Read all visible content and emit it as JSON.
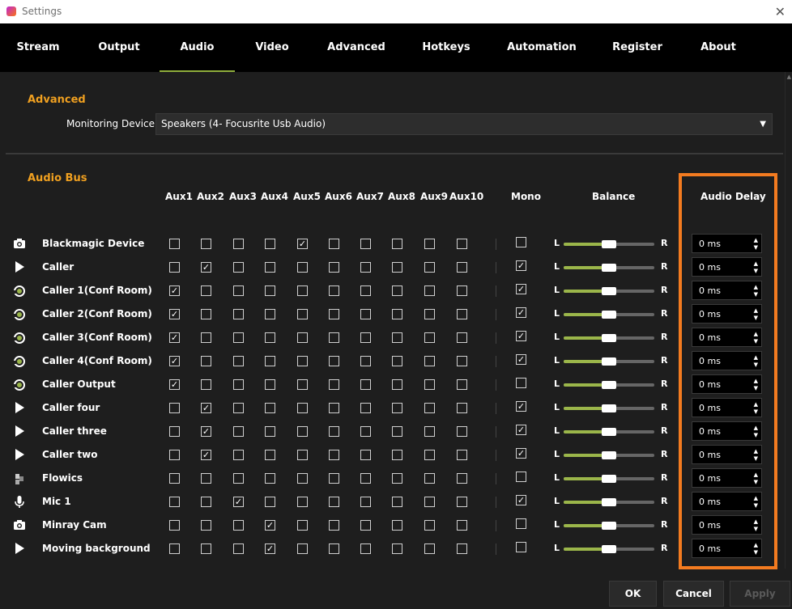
{
  "window": {
    "title": "Settings"
  },
  "tabs": [
    {
      "label": "Stream"
    },
    {
      "label": "Output"
    },
    {
      "label": "Audio"
    },
    {
      "label": "Video"
    },
    {
      "label": "Advanced"
    },
    {
      "label": "Hotkeys"
    },
    {
      "label": "Automation"
    },
    {
      "label": "Register"
    },
    {
      "label": "About"
    }
  ],
  "active_tab": "Audio",
  "advanced": {
    "title": "Advanced",
    "monitoring_label": "Monitoring Device",
    "monitoring_value": "Speakers (4- Focusrite Usb Audio)"
  },
  "audio_bus": {
    "title": "Audio Bus",
    "aux_headers": [
      "Aux1",
      "Aux2",
      "Aux3",
      "Aux4",
      "Aux5",
      "Aux6",
      "Aux7",
      "Aux8",
      "Aux9",
      "Aux10"
    ],
    "mono_header": "Mono",
    "balance_header": "Balance",
    "delay_header": "Audio Delay",
    "balance_left": "L",
    "balance_right": "R",
    "rows": [
      {
        "name": "Blackmagic Device",
        "icon": "camera-icon",
        "aux": [
          0,
          0,
          0,
          0,
          1,
          0,
          0,
          0,
          0,
          0
        ],
        "mono": 0,
        "balance": 0.5,
        "delay": "0 ms"
      },
      {
        "name": "Caller",
        "icon": "play-icon",
        "aux": [
          0,
          1,
          0,
          0,
          0,
          0,
          0,
          0,
          0,
          0
        ],
        "mono": 1,
        "balance": 0.5,
        "delay": "0 ms"
      },
      {
        "name": "Caller 1(Conf Room)",
        "icon": "refresh-icon",
        "aux": [
          1,
          0,
          0,
          0,
          0,
          0,
          0,
          0,
          0,
          0
        ],
        "mono": 1,
        "balance": 0.5,
        "delay": "0 ms"
      },
      {
        "name": "Caller 2(Conf Room)",
        "icon": "refresh-icon",
        "aux": [
          1,
          0,
          0,
          0,
          0,
          0,
          0,
          0,
          0,
          0
        ],
        "mono": 1,
        "balance": 0.5,
        "delay": "0 ms"
      },
      {
        "name": "Caller 3(Conf Room)",
        "icon": "refresh-icon",
        "aux": [
          1,
          0,
          0,
          0,
          0,
          0,
          0,
          0,
          0,
          0
        ],
        "mono": 1,
        "balance": 0.5,
        "delay": "0 ms"
      },
      {
        "name": "Caller 4(Conf Room)",
        "icon": "refresh-icon",
        "aux": [
          1,
          0,
          0,
          0,
          0,
          0,
          0,
          0,
          0,
          0
        ],
        "mono": 1,
        "balance": 0.5,
        "delay": "0 ms"
      },
      {
        "name": "Caller Output",
        "icon": "refresh-icon",
        "aux": [
          1,
          0,
          0,
          0,
          0,
          0,
          0,
          0,
          0,
          0
        ],
        "mono": 0,
        "balance": 0.5,
        "delay": "0 ms"
      },
      {
        "name": "Caller four",
        "icon": "play-icon",
        "aux": [
          0,
          1,
          0,
          0,
          0,
          0,
          0,
          0,
          0,
          0
        ],
        "mono": 1,
        "balance": 0.5,
        "delay": "0 ms"
      },
      {
        "name": "Caller three",
        "icon": "play-icon",
        "aux": [
          0,
          1,
          0,
          0,
          0,
          0,
          0,
          0,
          0,
          0
        ],
        "mono": 1,
        "balance": 0.5,
        "delay": "0 ms"
      },
      {
        "name": "Caller two",
        "icon": "play-icon",
        "aux": [
          0,
          1,
          0,
          0,
          0,
          0,
          0,
          0,
          0,
          0
        ],
        "mono": 1,
        "balance": 0.5,
        "delay": "0 ms"
      },
      {
        "name": "Flowics",
        "icon": "puzzle-icon",
        "aux": [
          0,
          0,
          0,
          0,
          0,
          0,
          0,
          0,
          0,
          0
        ],
        "mono": 0,
        "balance": 0.5,
        "delay": "0 ms"
      },
      {
        "name": "Mic 1",
        "icon": "microphone-icon",
        "aux": [
          0,
          0,
          1,
          0,
          0,
          0,
          0,
          0,
          0,
          0
        ],
        "mono": 1,
        "balance": 0.5,
        "delay": "0 ms"
      },
      {
        "name": "Minray Cam",
        "icon": "camera-icon",
        "aux": [
          0,
          0,
          0,
          1,
          0,
          0,
          0,
          0,
          0,
          0
        ],
        "mono": 0,
        "balance": 0.5,
        "delay": "0 ms"
      },
      {
        "name": "Moving background",
        "icon": "play-icon",
        "aux": [
          0,
          0,
          0,
          1,
          0,
          0,
          0,
          0,
          0,
          0
        ],
        "mono": 0,
        "balance": 0.5,
        "delay": "0 ms"
      }
    ]
  },
  "buttons": {
    "ok": "OK",
    "cancel": "Cancel",
    "apply": "Apply"
  },
  "colors": {
    "accent_orange": "#f0a020",
    "highlight": "#f37b20",
    "slider_green": "#9bb64a",
    "tab_underline": "#8fae3c"
  }
}
